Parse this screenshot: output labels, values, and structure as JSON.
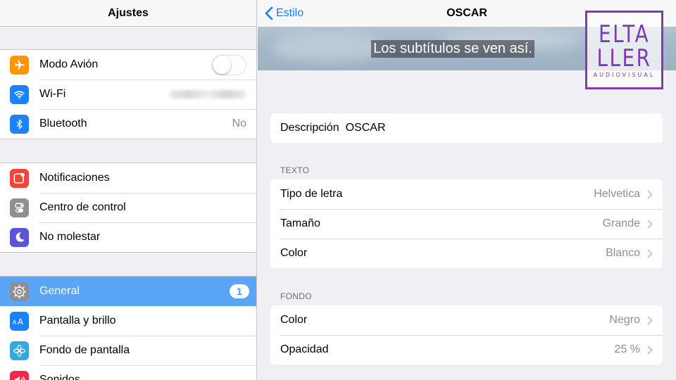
{
  "sidebar": {
    "title": "Ajustes",
    "groups": [
      [
        {
          "label": "Modo Avión",
          "icon": "airplane-icon",
          "color": "#ff9500",
          "control": "toggle",
          "toggle_on": false
        },
        {
          "label": "Wi-Fi",
          "icon": "wifi-icon",
          "color": "#1a82fb",
          "control": "blurred"
        },
        {
          "label": "Bluetooth",
          "icon": "bluetooth-icon",
          "color": "#1a82fb",
          "value": "No"
        }
      ],
      [
        {
          "label": "Notificaciones",
          "icon": "notifications-icon",
          "color": "#f2443a"
        },
        {
          "label": "Centro de control",
          "icon": "control-center-icon",
          "color": "#8e8e93"
        },
        {
          "label": "No molestar",
          "icon": "moon-icon",
          "color": "#5856d6"
        }
      ],
      [
        {
          "label": "General",
          "icon": "gear-icon",
          "color": "#8e8e93",
          "badge": "1",
          "selected": true
        },
        {
          "label": "Pantalla y brillo",
          "icon": "text-size-icon",
          "color": "#1a82fb"
        },
        {
          "label": "Fondo de pantalla",
          "icon": "wallpaper-icon",
          "color": "#34aadc"
        },
        {
          "label": "Sonidos",
          "icon": "speaker-icon",
          "color": "#f2294a"
        }
      ]
    ]
  },
  "detail": {
    "back_label": "Estilo",
    "title": "OSCAR",
    "preview_text": "Los subtítulos se ven así.",
    "description": {
      "label": "Descripción",
      "value": "OSCAR"
    },
    "sections": [
      {
        "header": "TEXTO",
        "rows": [
          {
            "label": "Tipo de letra",
            "value": "Helvetica"
          },
          {
            "label": "Tamaño",
            "value": "Grande"
          },
          {
            "label": "Color",
            "value": "Blanco"
          }
        ]
      },
      {
        "header": "FONDO",
        "rows": [
          {
            "label": "Color",
            "value": "Negro"
          },
          {
            "label": "Opacidad",
            "value": "25 %"
          }
        ]
      }
    ]
  },
  "watermark": {
    "line1": "ELTA",
    "line2": "LLER",
    "line3": "AUDIOVISUAL",
    "color": "#7f3bb0"
  },
  "colors": {
    "accent": "#1f7cf6",
    "selected_row": "#5aa5f6",
    "secondary_text": "#8e8e93"
  }
}
